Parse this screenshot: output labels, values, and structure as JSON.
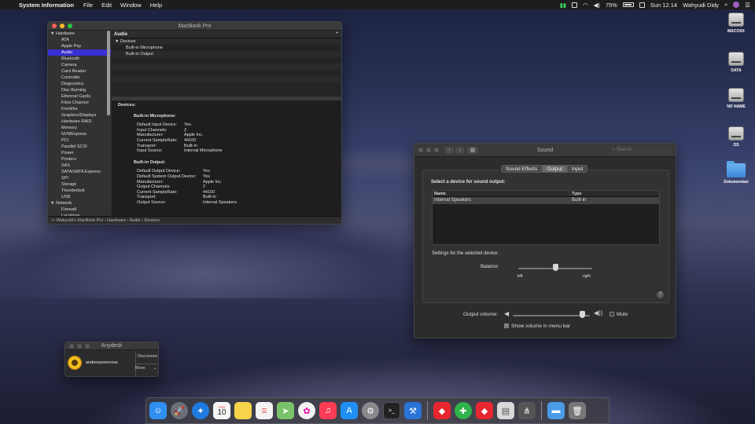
{
  "menubar": {
    "apple": "",
    "app_name": "System Information",
    "menus": [
      "File",
      "Edit",
      "Window",
      "Help"
    ],
    "battery": "75%",
    "clock": "Sun 12.14",
    "user": "Wahyudi Didy"
  },
  "sysinfo": {
    "title": "MacBook Pro",
    "sidebar": [
      {
        "label": "Hardware",
        "section": true
      },
      {
        "label": "ATA"
      },
      {
        "label": "Apple Pay"
      },
      {
        "label": "Audio",
        "selected": true
      },
      {
        "label": "Bluetooth"
      },
      {
        "label": "Camera"
      },
      {
        "label": "Card Reader"
      },
      {
        "label": "Controller"
      },
      {
        "label": "Diagnostics"
      },
      {
        "label": "Disc Burning"
      },
      {
        "label": "Ethernet Cards"
      },
      {
        "label": "Fibre Channel"
      },
      {
        "label": "FireWire"
      },
      {
        "label": "Graphics/Displays"
      },
      {
        "label": "Hardware RAID"
      },
      {
        "label": "Memory"
      },
      {
        "label": "NVMExpress"
      },
      {
        "label": "PCI"
      },
      {
        "label": "Parallel SCSI"
      },
      {
        "label": "Power"
      },
      {
        "label": "Printers"
      },
      {
        "label": "SAS"
      },
      {
        "label": "SATA/SATA Express"
      },
      {
        "label": "SPI"
      },
      {
        "label": "Storage"
      },
      {
        "label": "Thunderbolt"
      },
      {
        "label": "USB"
      },
      {
        "label": "Network",
        "section": true
      },
      {
        "label": "Firewall"
      },
      {
        "label": "Locations"
      }
    ],
    "header": "Audio",
    "tree": {
      "devices": "Devices",
      "children": [
        "Built-in Microphone",
        "Built-in Output"
      ]
    },
    "detail": {
      "title": "Devices:",
      "mic_title": "Built-in Microphone:",
      "mic": [
        [
          "Default Input Device:",
          "Yes"
        ],
        [
          "Input Channels:",
          "2"
        ],
        [
          "Manufacturer:",
          "Apple Inc."
        ],
        [
          "Current SampleRate:",
          "44100"
        ],
        [
          "Transport:",
          "Built-in"
        ],
        [
          "Input Source:",
          "Internal Microphone"
        ]
      ],
      "out_title": "Built-in Output:",
      "out": [
        [
          "Default Output Device:",
          "Yes"
        ],
        [
          "Default System Output Device:",
          "Yes"
        ],
        [
          "Manufacturer:",
          "Apple Inc."
        ],
        [
          "Output Channels:",
          "2"
        ],
        [
          "Current SampleRate:",
          "44100"
        ],
        [
          "Transport:",
          "Built-in"
        ],
        [
          "Output Source:",
          "Internal Speakers"
        ]
      ]
    },
    "status": "Wahyudi's MacBook Pro › Hardware › Audio › Devices"
  },
  "sound": {
    "title": "Sound",
    "search_placeholder": "Search",
    "tabs": [
      "Sound Effects",
      "Output",
      "Input"
    ],
    "active_tab": "Output",
    "select_label": "Select a device for sound output:",
    "table_headers": [
      "Name",
      "Type"
    ],
    "rows": [
      [
        "Internal Speakers",
        "Built-in"
      ]
    ],
    "settings_label": "Settings for the selected device:",
    "balance_label": "Balance:",
    "balance_left": "left",
    "balance_right": "right",
    "balance_value": 0.5,
    "help": "?",
    "volume_label": "Output volume:",
    "volume_value": 0.9,
    "mute_label": "Mute",
    "mute_checked": false,
    "show_volume_label": "Show volume in menu bar",
    "show_volume_checked": true
  },
  "anydesk": {
    "title": "Anydesk",
    "user": "andreszerocross",
    "status": "Disconnec",
    "more": "More"
  },
  "desktop_icons": [
    {
      "label": "MACOSX",
      "kind": "drive"
    },
    {
      "label": "DATA",
      "kind": "drive"
    },
    {
      "label": "NO NAME",
      "kind": "drive"
    },
    {
      "label": "OS",
      "kind": "drive"
    },
    {
      "label": "Dokumentasi",
      "kind": "folder"
    }
  ],
  "dock": {
    "calendar_month": "FEB",
    "calendar_day": "10",
    "apps": [
      {
        "name": "finder",
        "color": "#2f8ff0"
      },
      {
        "name": "launchpad",
        "color": "#6b6f78"
      },
      {
        "name": "safari",
        "color": "#1f7be0"
      },
      {
        "name": "calendar",
        "color": "#f5f5f5"
      },
      {
        "name": "notes",
        "color": "#f7d34a"
      },
      {
        "name": "reminders",
        "color": "#f3f3f3"
      },
      {
        "name": "maps",
        "color": "#7ac26a"
      },
      {
        "name": "photos",
        "color": "#f2f2f2"
      },
      {
        "name": "music",
        "color": "#fc3c55"
      },
      {
        "name": "app-store",
        "color": "#1f8ff5"
      },
      {
        "name": "system-preferences",
        "color": "#8a8a8e"
      },
      {
        "name": "terminal",
        "color": "#222"
      },
      {
        "name": "xcode",
        "color": "#2a74d8"
      },
      {
        "name": "anydesk",
        "color": "#e8262f"
      },
      {
        "name": "utility-green",
        "color": "#2fb34a"
      },
      {
        "name": "anydesk-2",
        "color": "#e8262f"
      },
      {
        "name": "preview",
        "color": "#d9d9d9"
      },
      {
        "name": "network-tool",
        "color": "#555"
      },
      {
        "name": "downloads-folder",
        "color": "#4a9be8"
      },
      {
        "name": "trash",
        "color": "#777"
      }
    ]
  }
}
